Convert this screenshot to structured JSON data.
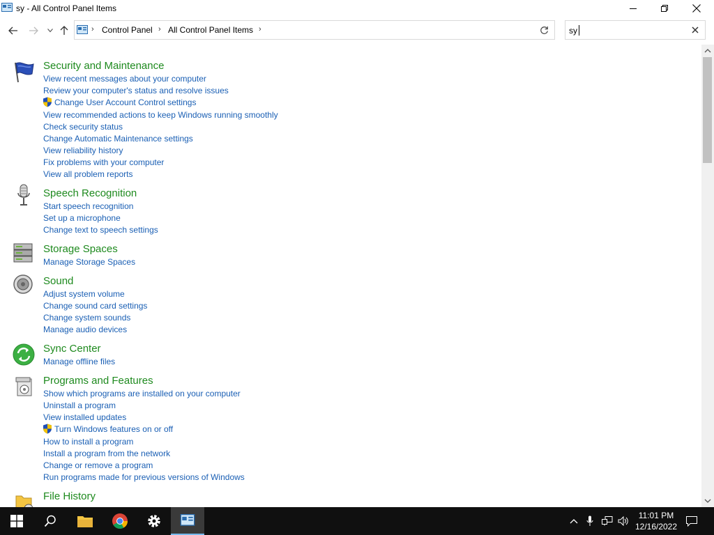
{
  "window": {
    "title": "sy - All Control Panel Items"
  },
  "address": {
    "crumbs": [
      "Control Panel",
      "All Control Panel Items"
    ]
  },
  "search": {
    "value": "sy"
  },
  "sections": [
    {
      "title": "Security and Maintenance",
      "icon": "flag-icon",
      "links": [
        {
          "label": "View recent messages about your computer"
        },
        {
          "label": "Review your computer's status and resolve issues"
        },
        {
          "label": "Change User Account Control settings",
          "shield": true
        },
        {
          "label": "View recommended actions to keep Windows running smoothly"
        },
        {
          "label": "Check security status"
        },
        {
          "label": "Change Automatic Maintenance settings"
        },
        {
          "label": "View reliability history"
        },
        {
          "label": "Fix problems with your computer"
        },
        {
          "label": "View all problem reports"
        }
      ]
    },
    {
      "title": "Speech Recognition",
      "icon": "microphone-icon",
      "links": [
        {
          "label": "Start speech recognition"
        },
        {
          "label": "Set up a microphone"
        },
        {
          "label": "Change text to speech settings"
        }
      ]
    },
    {
      "title": "Storage Spaces",
      "icon": "storage-spaces-icon",
      "links": [
        {
          "label": "Manage Storage Spaces"
        }
      ]
    },
    {
      "title": "Sound",
      "icon": "speaker-icon",
      "links": [
        {
          "label": "Adjust system volume"
        },
        {
          "label": "Change sound card settings"
        },
        {
          "label": "Change system sounds"
        },
        {
          "label": "Manage audio devices"
        }
      ]
    },
    {
      "title": "Sync Center",
      "icon": "sync-icon",
      "links": [
        {
          "label": "Manage offline files"
        }
      ]
    },
    {
      "title": "Programs and Features",
      "icon": "programs-icon",
      "links": [
        {
          "label": "Show which programs are installed on your computer"
        },
        {
          "label": "Uninstall a program"
        },
        {
          "label": "View installed updates"
        },
        {
          "label": "Turn Windows features on or off",
          "shield": true
        },
        {
          "label": "How to install a program"
        },
        {
          "label": "Install a program from the network"
        },
        {
          "label": "Change or remove a program"
        },
        {
          "label": "Run programs made for previous versions of Windows"
        }
      ]
    },
    {
      "title": "File History",
      "icon": "file-history-icon",
      "links": []
    }
  ],
  "taskbar": {
    "time": "11:01 PM",
    "date": "12/16/2022"
  },
  "colors": {
    "heading": "#1e8a1e",
    "link": "#1a5fb4",
    "taskbar": "#101010"
  }
}
